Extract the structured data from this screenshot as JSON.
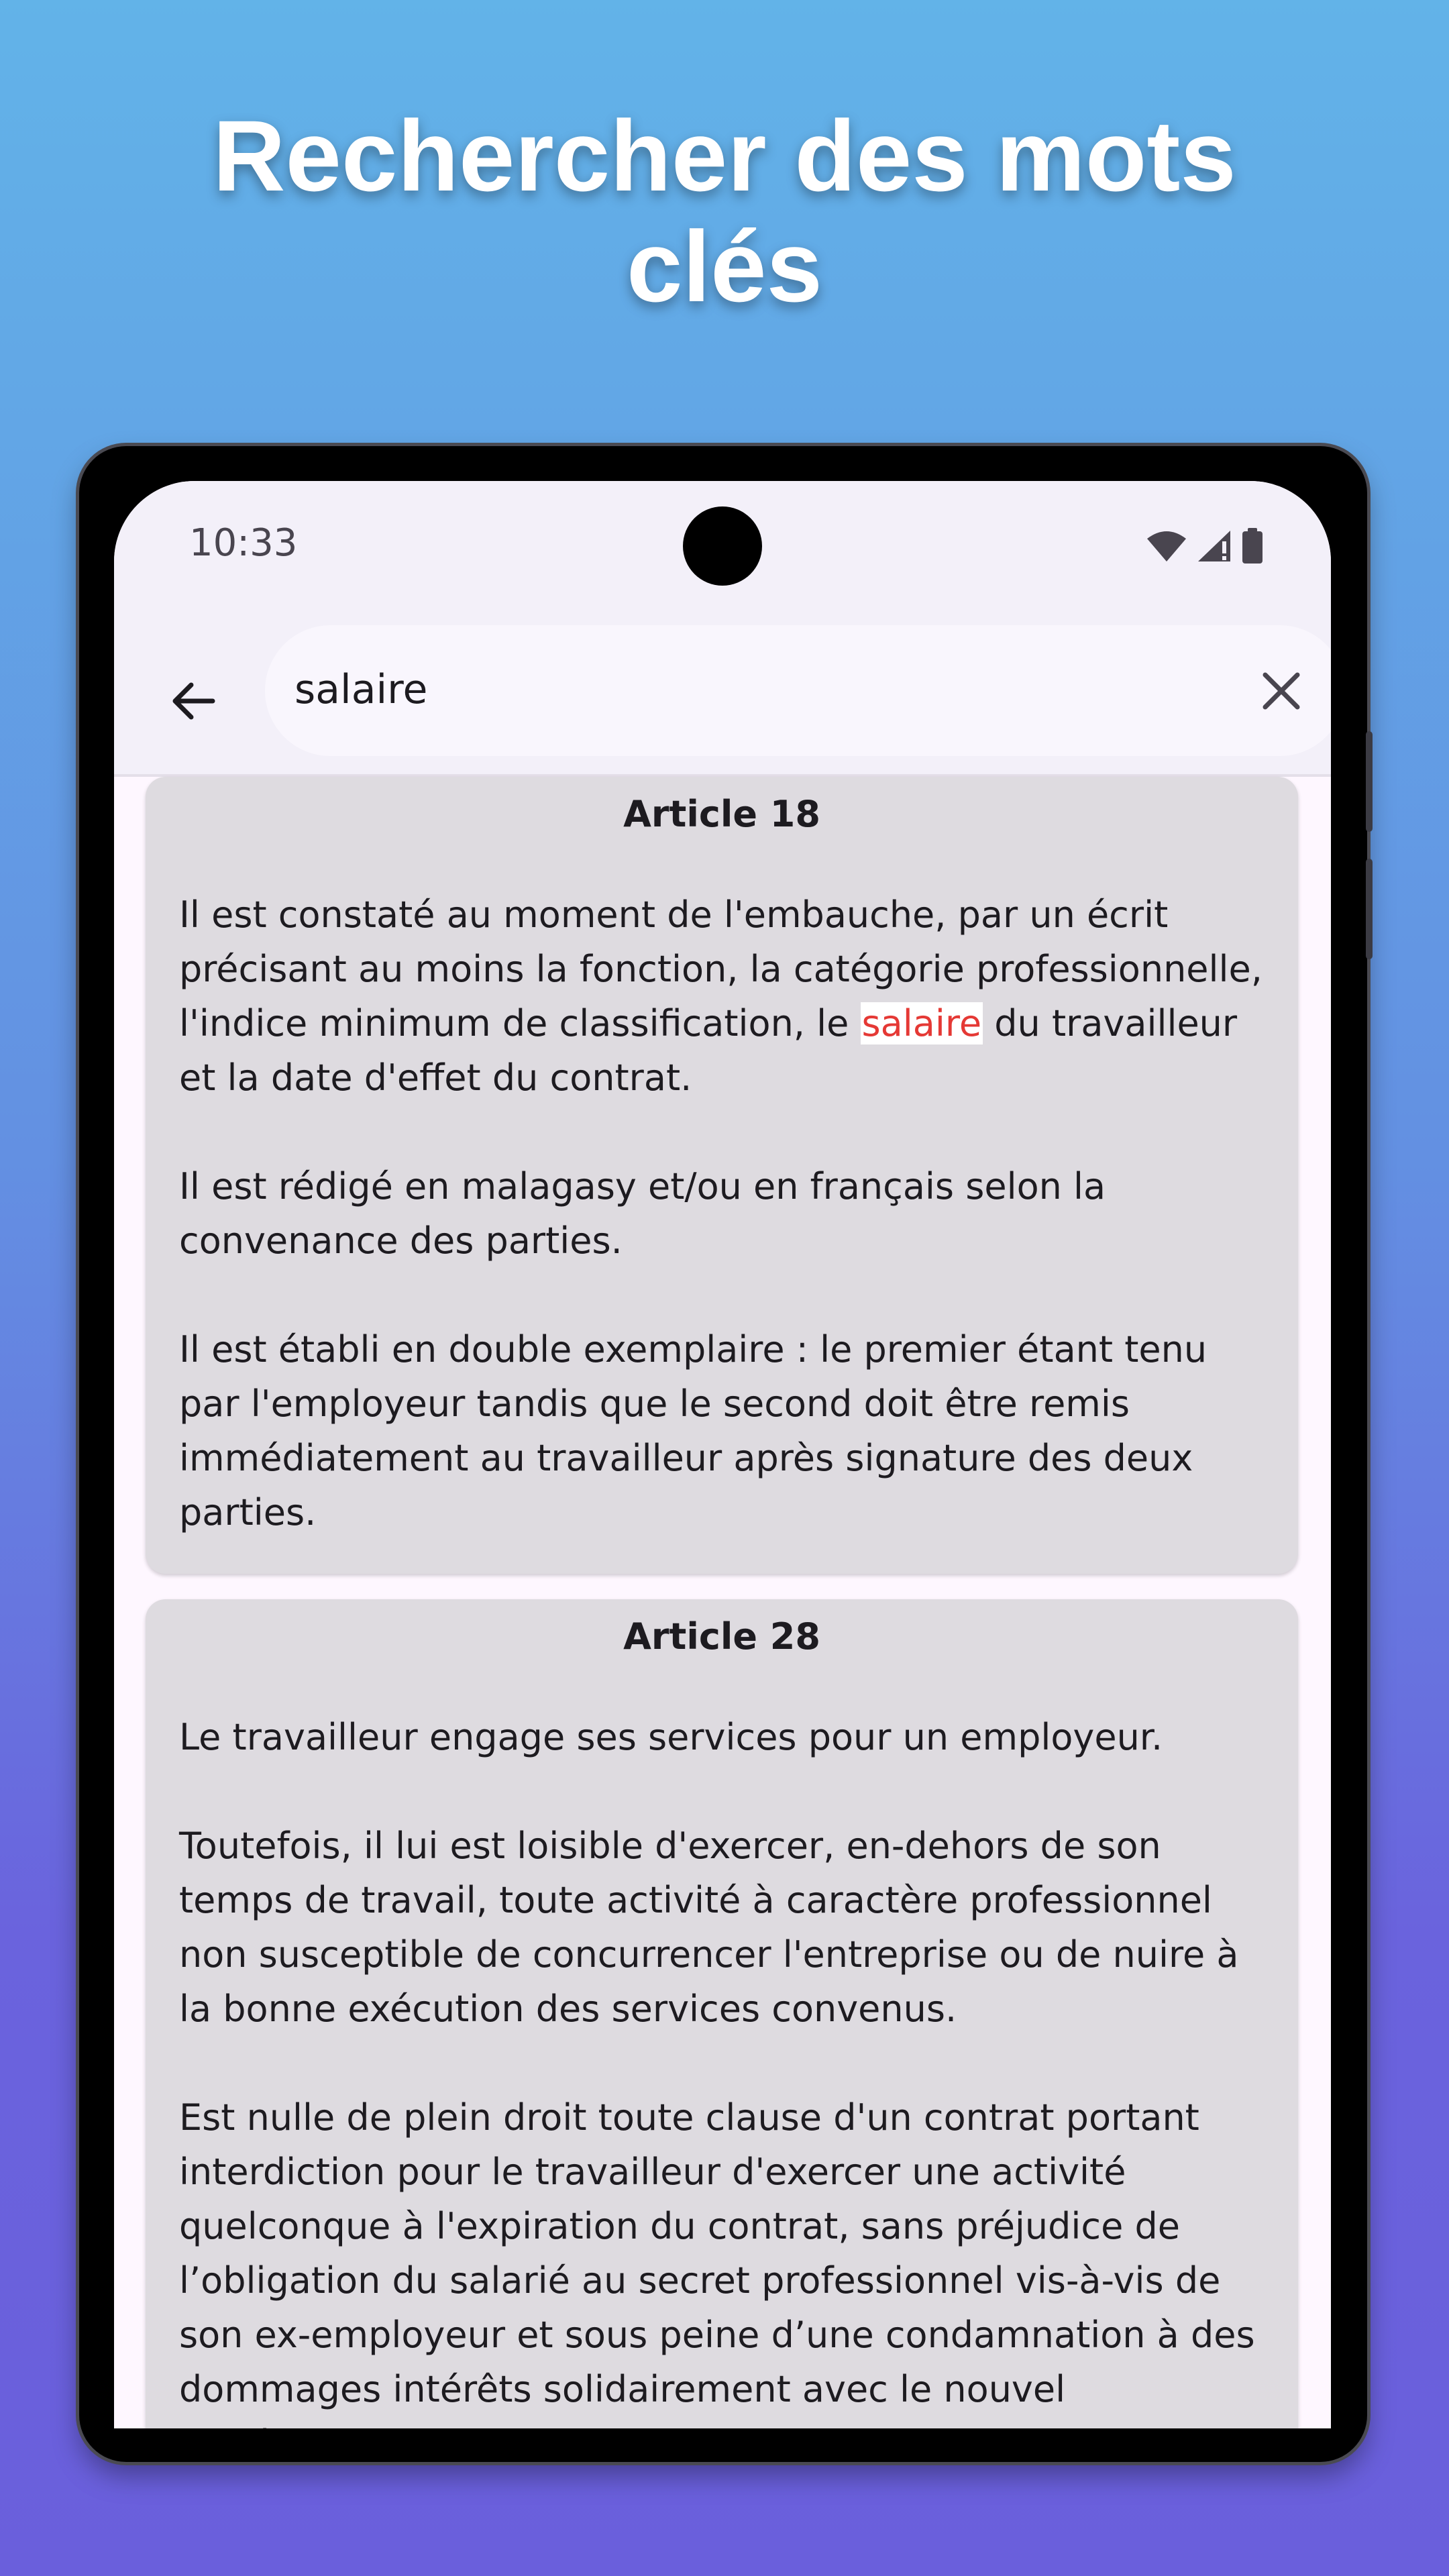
{
  "promo": {
    "headline_line1": "Rechercher des mots",
    "headline_line2": "clés"
  },
  "status_bar": {
    "time": "10:33",
    "icons": [
      "wifi-icon",
      "signal-icon",
      "battery-icon"
    ]
  },
  "search": {
    "back_icon": "arrow-back-icon",
    "query": "salaire",
    "clear_icon": "close-icon"
  },
  "results": [
    {
      "title": "Article 18",
      "p1_before": "Il est constaté au moment de l'embauche, par un écrit précisant au moins la fonction, la catégorie professionnelle, l'indice minimum de classification, le ",
      "p1_highlight": "salaire",
      "p1_after": " du travailleur et la date d'effet du contrat.",
      "p2": "Il est rédigé en malagasy et/ou en français selon la convenance des parties.",
      "p3": "Il est établi en double exemplaire : le premier étant tenu par l'employeur tandis que le second doit être remis immédiatement au travailleur après signature des deux parties."
    },
    {
      "title": "Article 28",
      "p1": "Le travailleur engage ses services pour un employeur.",
      "p2": "Toutefois, il lui est loisible d'exercer, en-dehors de son temps de travail, toute activité à caractère professionnel non susceptible de concurrencer l'entreprise ou de nuire à la bonne exécution des services convenus.",
      "p3": "Est nulle de plein droit toute clause d'un contrat portant interdiction pour le travailleur d'exercer une activité quelconque à l'expiration du contrat, sans préjudice de l’obligation du salarié au secret professionnel vis-à-vis de son ex-employeur et sous peine d’une condamnation à des dommages intérêts solidairement avec le nouvel employeur."
    }
  ],
  "colors": {
    "highlight_text": "#e53935",
    "card_background": "#dedbe0",
    "app_bar": "#f3f0f9"
  }
}
